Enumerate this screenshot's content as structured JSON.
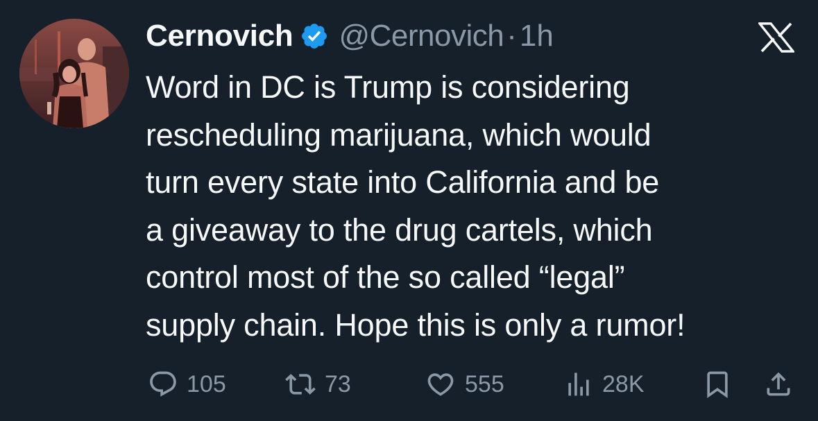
{
  "author": {
    "display_name": "Cernovich",
    "handle": "@Cernovich",
    "separator": "·",
    "time": "1h",
    "verified": true,
    "avatar_icon": "profile-photo"
  },
  "platform_logo": "X",
  "tweet": {
    "lines": [
      "Word in DC is Trump is considering",
      "rescheduling marijuana, which would",
      "turn every state into California and be",
      "a giveaway to the drug cartels, which",
      "control most of the so called “legal”",
      "supply chain. Hope this is only a rumor!"
    ]
  },
  "actions": {
    "replies": "105",
    "reposts": "73",
    "likes": "555",
    "views": "28K"
  },
  "colors": {
    "background": "#15202b",
    "text": "#f7f9f9",
    "muted": "#8b98a5",
    "verified_badge": "#1d9bf0"
  }
}
